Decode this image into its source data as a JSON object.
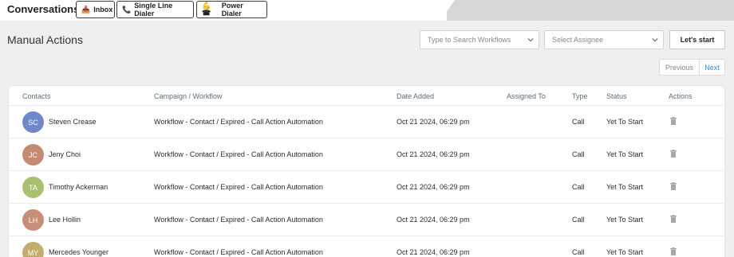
{
  "topbar": {
    "title": "Conversations",
    "tabs": [
      {
        "label": "Inbox",
        "icon": "inbox-icon",
        "glyph": "📥"
      },
      {
        "label": "Single Line Dialer",
        "icon": "phone-icon",
        "glyph": "📞"
      },
      {
        "label": "Power Dialer",
        "icon": "power-dialer-icon",
        "glyph": "💪☎"
      }
    ]
  },
  "header": {
    "title": "Manual Actions",
    "workflow_search_placeholder": "Type to Search Workflows",
    "assignee_placeholder": "Select Assignee",
    "start_label": "Let's start"
  },
  "pager": {
    "previous": "Previous",
    "next": "Next"
  },
  "table": {
    "headers": [
      "Contacts",
      "Campaign / Workflow",
      "Date Added",
      "Assigned To",
      "Type",
      "Status",
      "Actions"
    ],
    "rows": [
      {
        "initials": "SC",
        "name": "Steven Crease",
        "workflow": "Workflow - Contact / Expired - Call Action Automation",
        "date": "Oct 21 2024, 06:29 pm",
        "assigned": "",
        "type": "Call",
        "status": "Yet To Start",
        "color": "#6e88c8"
      },
      {
        "initials": "JC",
        "name": "Jeny Choi",
        "workflow": "Workflow - Contact / Expired - Call Action Automation",
        "date": "Oct 21 2024, 06:29 pm",
        "assigned": "",
        "type": "Call",
        "status": "Yet To Start",
        "color": "#c48a72"
      },
      {
        "initials": "TA",
        "name": "Timothy Ackerman",
        "workflow": "Workflow - Contact / Expired - Call Action Automation",
        "date": "Oct 21 2024, 06:29 pm",
        "assigned": "",
        "type": "Call",
        "status": "Yet To Start",
        "color": "#a9c06f"
      },
      {
        "initials": "LH",
        "name": "Lee Hollin",
        "workflow": "Workflow - Contact / Expired - Call Action Automation",
        "date": "Oct 21 2024, 06:29 pm",
        "assigned": "",
        "type": "Call",
        "status": "Yet To Start",
        "color": "#c88f78"
      },
      {
        "initials": "MY",
        "name": "Mercedes Younger",
        "workflow": "Workflow - Contact / Expired - Call Action Automation",
        "date": "Oct 21 2024, 06:29 pm",
        "assigned": "",
        "type": "Call",
        "status": "Yet To Start",
        "color": "#c2ac6e"
      }
    ]
  },
  "colors": {
    "accent_link": "#3a8ad0",
    "page_bg": "#efefef",
    "header_text": "#5b6d80"
  }
}
